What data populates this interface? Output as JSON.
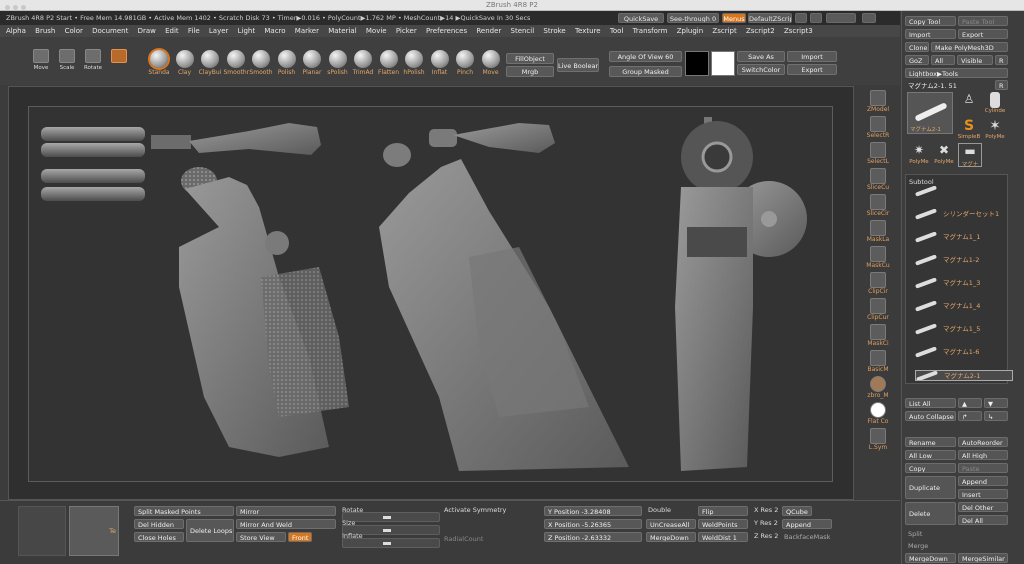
{
  "window": {
    "title": "ZBrush 4R8 P2"
  },
  "status": {
    "text": "ZBrush 4R8 P2 Start   • Free Mem 14.981GB • Active Mem 1402 • Scratch Disk 73 • Timer▶0.016 • PolyCount▶1.762 MP • MeshCount▶14  ▶QuickSave In 30 Secs"
  },
  "menus": [
    "Alpha",
    "Brush",
    "Color",
    "Document",
    "Draw",
    "Edit",
    "File",
    "Layer",
    "Light",
    "Macro",
    "Marker",
    "Material",
    "Movie",
    "Picker",
    "Preferences",
    "Render",
    "Stencil",
    "Stroke",
    "Texture",
    "Tool",
    "Transform",
    "Zplugin",
    "Zscript",
    "Zscript2",
    "Zscript3"
  ],
  "topbar": {
    "quicksave": "QuickSave",
    "seethrough": "See-through  0",
    "menus": "Menus",
    "defaultzscript": "DefaultZScript"
  },
  "tools": [
    {
      "label": "Move"
    },
    {
      "label": "Scale"
    },
    {
      "label": "Rotate"
    }
  ],
  "brushes": [
    "Standa",
    "Clay",
    "ClayBui",
    "Smoothr",
    "Smooth",
    "Polish",
    "Planar",
    "sPolish",
    "TrimAd",
    "Flatten",
    "hPolish",
    "Inflat",
    "Pinch",
    "Move"
  ],
  "shelf": {
    "fill_object": "FillObject",
    "mrgb": "Mrgb",
    "live_boolean": "Live Boolean",
    "angle_of_view": "Angle Of View 60",
    "group_masked": "Group Masked",
    "save_as": "Save As",
    "import": "Import",
    "switch_color": "SwitchColor",
    "export": "Export"
  },
  "right_shelf": [
    "ZModel",
    "SelectR",
    "SelectL",
    "SliceCu",
    "SliceCir",
    "MaskLa",
    "MaskCu",
    "ClipCir",
    "ClipCur",
    "MaskCi",
    "BasicM",
    "zbro_M",
    "Flat Co",
    "L.Sym"
  ],
  "panel": {
    "copy_tool": "Copy Tool",
    "paste_tool": "Paste Tool",
    "import": "Import",
    "export": "Export",
    "clone": "Clone",
    "make_polymesh": "Make PolyMesh3D",
    "goz": "GoZ",
    "all": "All",
    "visible": "Visible",
    "r": "R",
    "lightbox_tools": "Lightbox▶Tools",
    "current_tool": "マグナム2-1. 51",
    "r2": "R",
    "thumbs": [
      "マグナム2-1",
      "Cylinde",
      "SimpleB",
      "PolyMe",
      "PolyMe",
      "PolyMe",
      "マグナ"
    ],
    "subtool_title": "Subtool",
    "subtools": [
      "",
      "シリンダーセット1",
      "マグナム1_1",
      "マグナム1-2",
      "マグナム1_3",
      "マグナム1_4",
      "マグナム1_5",
      "マグナム1-6",
      "マグナム2-1"
    ],
    "list_all": "List All",
    "auto_collapse": "Auto Collapse",
    "rename": "Rename",
    "auto_reorder": "AutoReorder",
    "all_low": "All Low",
    "all_high": "All High",
    "copy": "Copy",
    "paste": "Paste",
    "duplicate": "Duplicate",
    "append": "Append",
    "insert": "Insert",
    "delete": "Delete",
    "del_other": "Del Other",
    "del_all": "Del All",
    "split": "Split",
    "merge": "Merge",
    "merge_down": "MergeDown",
    "merge_similar": "MergeSimilar"
  },
  "bottom": {
    "split_masked": "Split Masked Points",
    "del_hidden": "Del Hidden",
    "close_holes": "Close Holes",
    "delete_loops": "Delete Loops",
    "mirror": "Mirror",
    "mirror_weld": "Mirror And Weld",
    "store_view": "Store View",
    "front": "Front",
    "rotate": "Rotate",
    "size": "Size",
    "inflate": "Inflate",
    "activate_symmetry": "Activate Symmetry",
    "radial_count": "RadialCount",
    "ypos": "Y Position -3.28408",
    "xpos": "X Position -5.26365",
    "zpos": "Z Position -2.63332",
    "double": "Double",
    "uncrease_all": "UnCreaseAll",
    "merge_down": "MergeDown",
    "flip": "Flip",
    "weld_points": "WeldPoints",
    "weld_dist": "WeldDist 1",
    "xres": "X Res 2",
    "yres": "Y Res 2",
    "zres": "Z Res 2",
    "qcube": "QCube",
    "append": "Append",
    "backface_mask": "BackfaceMask",
    "te": "Te"
  },
  "colors": {
    "accent": "#d8761e",
    "primary_swatch": "#000000",
    "secondary_swatch": "#ffffff"
  }
}
